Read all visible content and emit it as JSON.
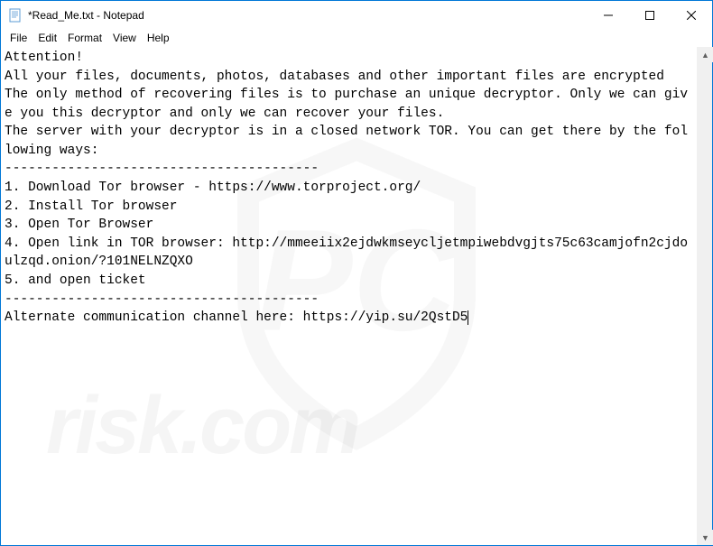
{
  "window": {
    "title": "*Read_Me.txt - Notepad"
  },
  "menu": {
    "file": "File",
    "edit": "Edit",
    "format": "Format",
    "view": "View",
    "help": "Help"
  },
  "content": {
    "line1": "Attention!",
    "line2": "",
    "line3": "All your files, documents, photos, databases and other important files are encrypted",
    "line4": "",
    "line5": "The only method of recovering files is to purchase an unique decryptor. Only we can give you this decryptor and only we can recover your files.",
    "line6": "",
    "line7": "",
    "line8": "The server with your decryptor is in a closed network TOR. You can get there by the following ways:",
    "line9": "",
    "line10": "----------------------------------------",
    "line11": "",
    "line12": "1. Download Tor browser - https://www.torproject.org/",
    "line13": "2. Install Tor browser",
    "line14": "3. Open Tor Browser",
    "line15": "4. Open link in TOR browser: http://mmeeiix2ejdwkmseycljetmpiwebdvgjts75c63camjofn2cjdoulzqd.onion/?101NELNZQXO",
    "line16": "5. and open ticket",
    "line17": "",
    "line18": "----------------------------------------",
    "line19": "",
    "line20": "",
    "line21": "",
    "line22": "Alternate communication channel here: https://yip.su/2QstD5"
  },
  "watermark": {
    "text": "risk.com",
    "brand": "PC"
  }
}
